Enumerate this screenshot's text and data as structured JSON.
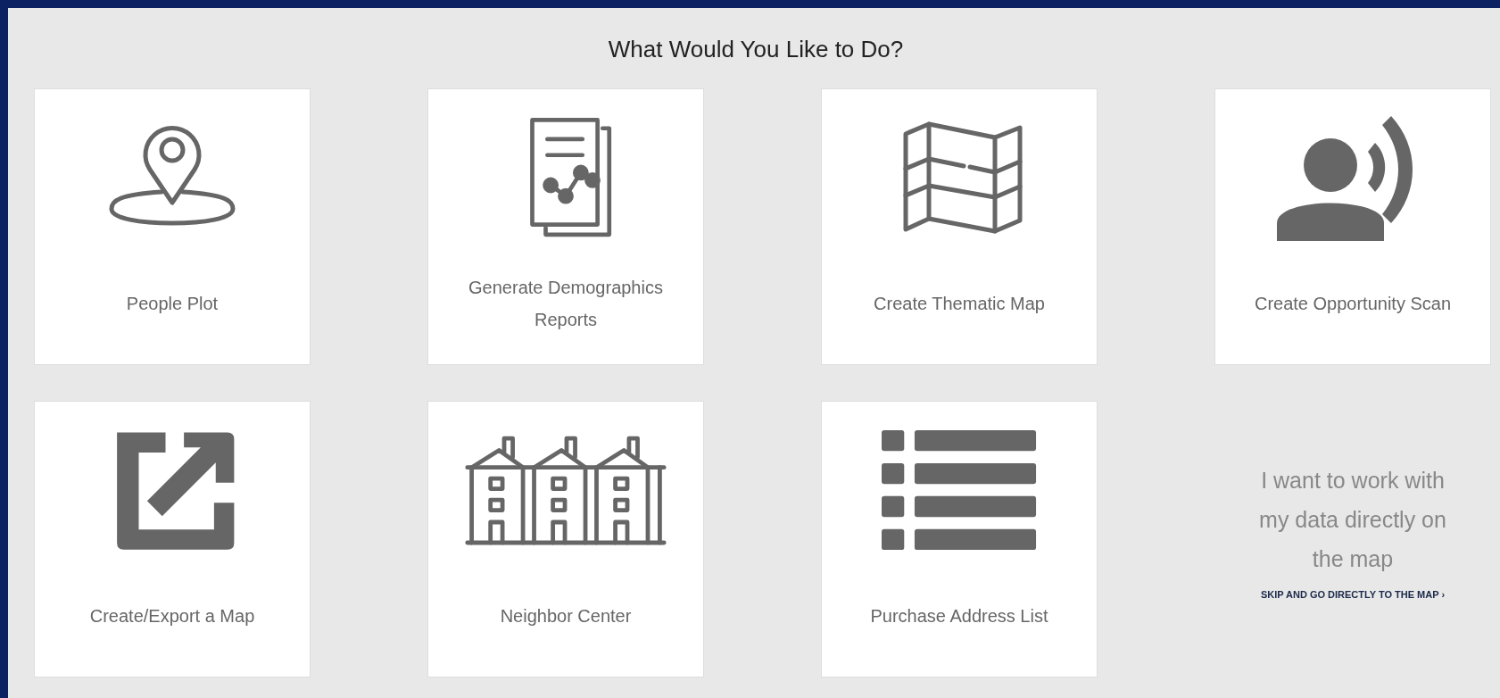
{
  "heading": "What Would You Like to Do?",
  "options": [
    {
      "kind": "card",
      "label": "People Plot"
    },
    {
      "kind": "card",
      "label": "Generate Demographics Reports"
    },
    {
      "kind": "card",
      "label": "Create Thematic Map"
    },
    {
      "kind": "card",
      "label": "Create Opportunity Scan"
    },
    {
      "kind": "card",
      "label": "Create/Export a Map"
    },
    {
      "kind": "card",
      "label": "Neighbor Center"
    },
    {
      "kind": "card",
      "label": "Purchase Address List"
    },
    {
      "kind": "message",
      "text": "I want to work with my data directly on the map",
      "link": "SKIP AND GO DIRECTLY TO THE MAP ›"
    }
  ]
}
